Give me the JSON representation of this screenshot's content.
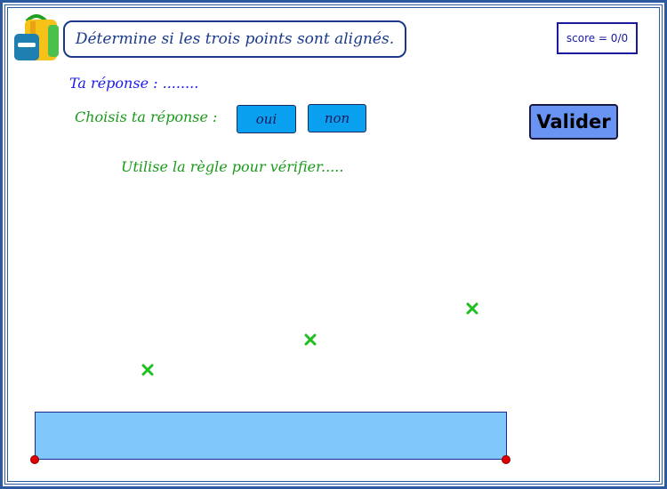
{
  "instruction": "Détermine si les trois points sont alignés.",
  "score": "score = 0/0",
  "answer": {
    "label": "Ta réponse :",
    "value": "........"
  },
  "choose": {
    "label": "Choisis ta réponse :"
  },
  "buttons": {
    "oui": "oui",
    "non": "non",
    "validate": "Valider"
  },
  "hint": "Utilise la règle pour vérifier.....",
  "colors": {
    "frame": "#2c5aa0",
    "choice": "#0aa0f0",
    "validate": "#6a94f4",
    "ruler": "#80c8fc",
    "points": "#1fbf1f",
    "handles": "#e00000"
  },
  "icons": [
    "school-bag-icon",
    "point-cross-icon",
    "ruler-handle-icon"
  ]
}
